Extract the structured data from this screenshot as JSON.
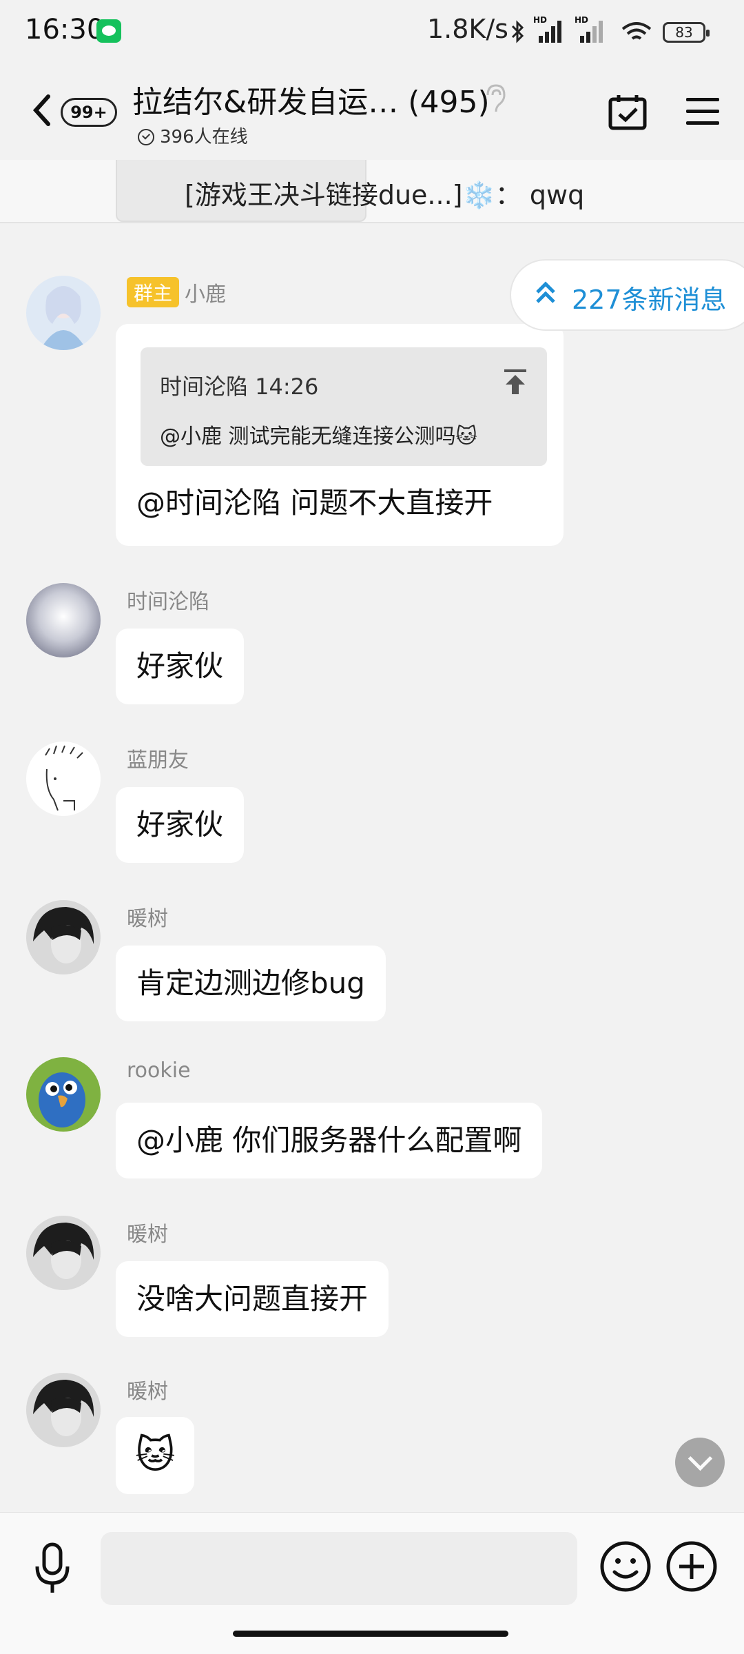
{
  "status_bar": {
    "time": "16:30",
    "network_speed": "1.8K/s",
    "battery": "83",
    "icons": [
      "wechat-icon",
      "bluetooth-icon",
      "signal-hd-icon",
      "signal-hd-icon",
      "wifi-icon",
      "battery-icon"
    ]
  },
  "header": {
    "unread_count": "99+",
    "title": "拉结尔&研发自运… (495)",
    "online_count": "396人在线"
  },
  "pinned": {
    "text": "[游戏王决斗链接due...]",
    "emoji": "❄️",
    "suffix": "： qwq"
  },
  "new_messages": {
    "label": "227条新消息"
  },
  "messages": [
    {
      "sender": "小鹿",
      "badge": "群主",
      "quote": {
        "meta": "时间沦陷 14:26",
        "text": "@小鹿 测试完能无缝连接公测吗🐱"
      },
      "text": "@时间沦陷  问题不大直接开"
    },
    {
      "sender": "时间沦陷",
      "text": "好家伙"
    },
    {
      "sender": "蓝朋友",
      "text": "好家伙"
    },
    {
      "sender": "暖树",
      "text": "肯定边测边修bug"
    },
    {
      "sender": "rookie",
      "text": "@小鹿 你们服务器什么配置啊"
    },
    {
      "sender": "暖树",
      "text": "没啥大问题直接开"
    },
    {
      "sender": "暖树",
      "text": "🐱"
    }
  ],
  "input": {
    "placeholder": ""
  },
  "colors": {
    "background": "#f2f2f2",
    "bubble": "#ffffff",
    "accent_blue": "#1e8fd6",
    "owner_badge": "#f6c22b"
  }
}
